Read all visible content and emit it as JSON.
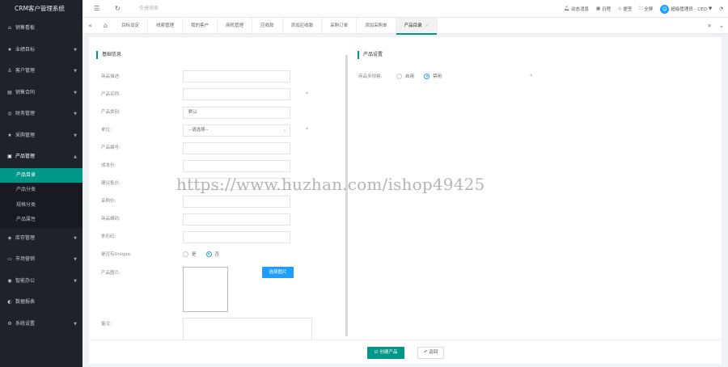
{
  "app": {
    "title": "CRM客户管理系统"
  },
  "sidebar": {
    "items": [
      {
        "label": "销售看板",
        "icon": "home-icon",
        "glyph": "⌂",
        "arrow": ""
      },
      {
        "label": "业绩目标",
        "icon": "star-icon",
        "glyph": "★",
        "arrow": "▼"
      },
      {
        "label": "客户管理",
        "icon": "user-icon",
        "glyph": "♙",
        "arrow": "▼"
      },
      {
        "label": "销售合同",
        "icon": "contract-icon",
        "glyph": "▤",
        "arrow": "▼"
      },
      {
        "label": "财务管理",
        "icon": "finance-icon",
        "glyph": "◎",
        "arrow": "▼"
      },
      {
        "label": "采购管理",
        "icon": "purchase-icon",
        "glyph": "★",
        "arrow": "▼"
      },
      {
        "label": "产品管理",
        "icon": "product-icon",
        "glyph": "▣",
        "arrow": "▲"
      }
    ],
    "sub_items": [
      {
        "label": "产品目录",
        "active": true
      },
      {
        "label": "产品分类",
        "active": false
      },
      {
        "label": "规格分类",
        "active": false
      },
      {
        "label": "产品属性",
        "active": false
      }
    ],
    "items_after": [
      {
        "label": "库存管理",
        "icon": "stock-icon",
        "glyph": "◈",
        "arrow": "▼"
      },
      {
        "label": "市场营销",
        "icon": "marketing-icon",
        "glyph": "▭",
        "arrow": "▼"
      },
      {
        "label": "智能办公",
        "icon": "office-icon",
        "glyph": "◉",
        "arrow": "▼"
      },
      {
        "label": "数据报表",
        "icon": "report-icon",
        "glyph": "◐",
        "arrow": ""
      },
      {
        "label": "系统设置",
        "icon": "settings-icon",
        "glyph": "⚙",
        "arrow": "▼"
      }
    ]
  },
  "topbar": {
    "menu_glyph": "☰",
    "refresh_glyph": "↻",
    "search_placeholder": "快捷搜索",
    "right": [
      {
        "label": "动态消息",
        "icon": "bell-icon",
        "glyph": "🔔︎"
      },
      {
        "label": "日程",
        "icon": "calendar-icon",
        "glyph": "▦"
      },
      {
        "label": "便签",
        "icon": "tag-icon",
        "glyph": "◇"
      },
      {
        "label": "全屏",
        "icon": "fullscreen-icon",
        "glyph": "⛶"
      }
    ],
    "user": {
      "avatar_char": "☺",
      "name": "超级管理员 - CEO",
      "caret": "▼"
    },
    "theme_glyph": "◔"
  },
  "tabs": {
    "nav_left": "«",
    "home_glyph": "⌂",
    "nav_right": "»",
    "items": [
      {
        "label": "目标设定",
        "active": false
      },
      {
        "label": "线索管理",
        "active": false
      },
      {
        "label": "我的客户",
        "active": false
      },
      {
        "label": "商机管理",
        "active": false
      },
      {
        "label": "应收款",
        "active": false
      },
      {
        "label": "添加应收款",
        "active": false
      },
      {
        "label": "采购订单",
        "active": false
      },
      {
        "label": "添加采购单",
        "active": false
      },
      {
        "label": "产品目录",
        "active": true
      }
    ],
    "close_glyph": "×",
    "more_glyph": "⌄"
  },
  "form": {
    "basic_title": "基础信息",
    "product_title": "产品设置",
    "fields": [
      {
        "label": "商品描述:",
        "value": "",
        "type": "input"
      },
      {
        "label": "产品名称:",
        "value": "",
        "type": "input",
        "required": "*"
      },
      {
        "label": "产品类别:",
        "value": "默认",
        "type": "input"
      },
      {
        "label": "单位:",
        "value": "--请选择--",
        "type": "select",
        "required": "*"
      },
      {
        "label": "产品编号:",
        "value": "",
        "type": "input"
      },
      {
        "label": "成本价:",
        "value": "",
        "type": "input"
      },
      {
        "label": "建议售价:",
        "value": "",
        "type": "input"
      },
      {
        "label": "采购价:",
        "value": "",
        "type": "input"
      },
      {
        "label": "商品编码:",
        "value": "",
        "type": "input"
      },
      {
        "label": "条形码:",
        "value": "",
        "type": "input"
      }
    ],
    "unique_code": {
      "label": "是否有Unique:",
      "options": [
        "是",
        "否"
      ],
      "selected": "否"
    },
    "image": {
      "label": "产品图片:",
      "button": "选择图片"
    },
    "remark": {
      "label": "备注:"
    },
    "multi_spec": {
      "label": "商品多规格:",
      "options": [
        "启用",
        "禁用"
      ],
      "selected": "禁用",
      "required": "*"
    }
  },
  "footer": {
    "create_label": "创建产品",
    "create_glyph": "☑",
    "back_label": "返回",
    "back_glyph": "↶"
  },
  "watermark": "https://www.huzhan.com/ishop49425"
}
